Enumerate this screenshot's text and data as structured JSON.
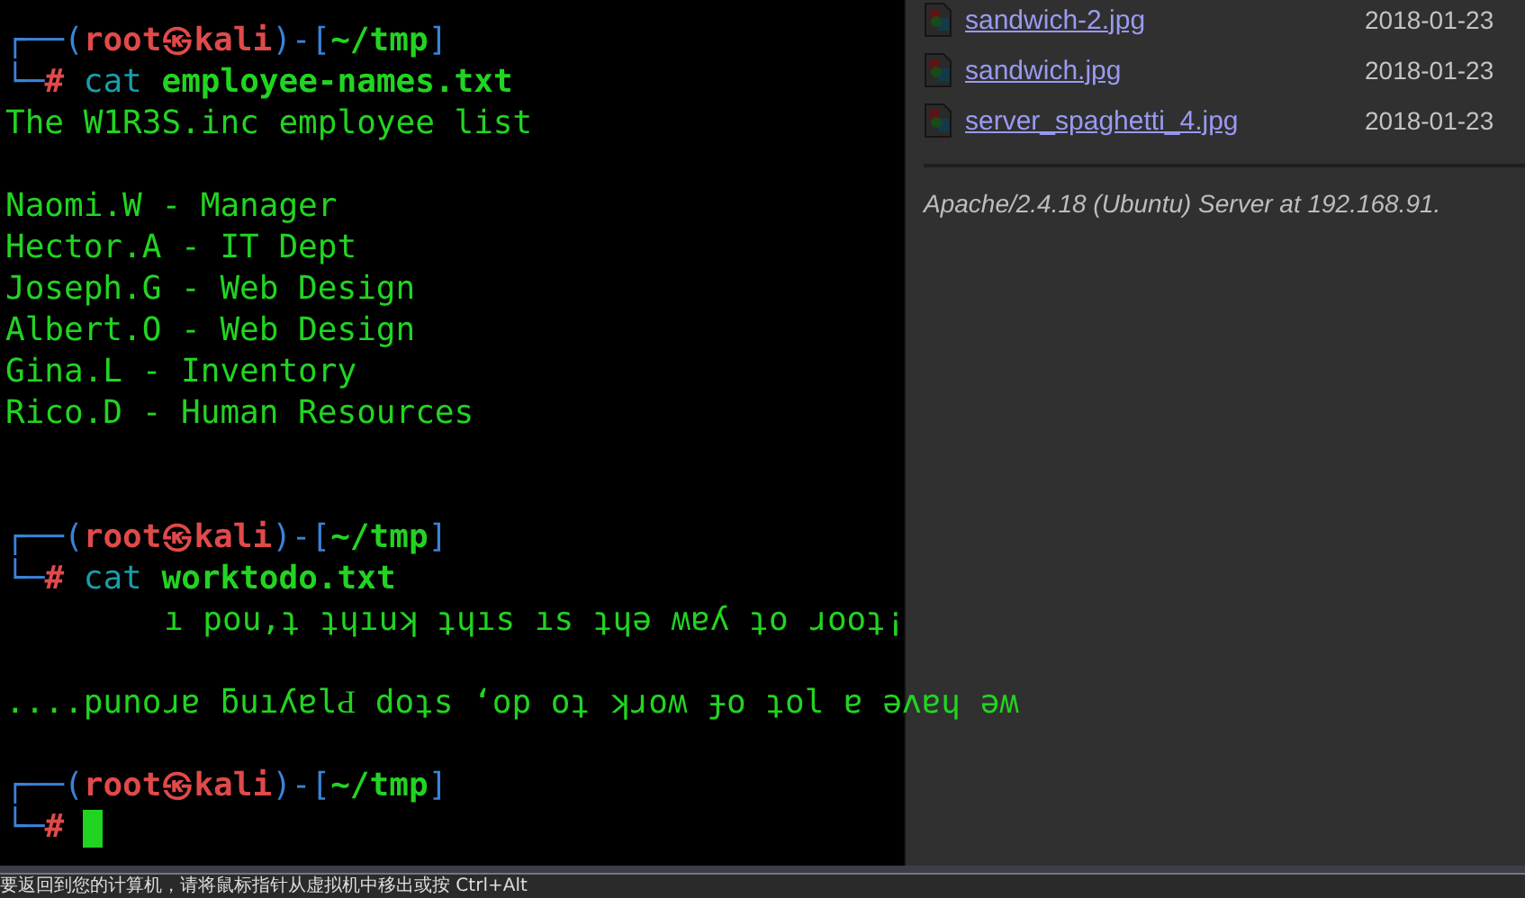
{
  "terminal": {
    "blocks": [
      {
        "prompt": {
          "frame_top": "┌──(",
          "user": "root",
          "separator": "㉿",
          "host": "kali",
          "path_open": ")-[",
          "path": "~/tmp",
          "path_close": "]",
          "frame_bottom": "└─",
          "symbol": "#"
        },
        "command": "cat",
        "argument": "employee-names.txt",
        "output": [
          {
            "kind": "text",
            "text": "The W1R3S.inc employee list"
          },
          {
            "kind": "blank"
          },
          {
            "kind": "text",
            "text": "Naomi.W - Manager"
          },
          {
            "kind": "text",
            "text": "Hector.A - IT Dept"
          },
          {
            "kind": "text",
            "text": "Joseph.G - Web Design"
          },
          {
            "kind": "text",
            "text": "Albert.O - Web Design"
          },
          {
            "kind": "text",
            "text": "Gina.L - Inventory"
          },
          {
            "kind": "text",
            "text": "Rico.D - Human Resources"
          },
          {
            "kind": "blank"
          },
          {
            "kind": "blank"
          }
        ]
      },
      {
        "prompt": {
          "frame_top": "┌──(",
          "user": "root",
          "separator": "㉿",
          "host": "kali",
          "path_open": ")-[",
          "path": "~/tmp",
          "path_close": "]",
          "frame_bottom": "└─",
          "symbol": "#"
        },
        "command": "cat",
        "argument": "worktodo.txt",
        "output": [
          {
            "kind": "indented",
            "text": "ı pou,ʇ ʇɥıuʞ ʇɥıs ıs ʇɥǝ ʍɐʎ ʇo ɹooʇ¡"
          },
          {
            "kind": "blank"
          },
          {
            "kind": "text",
            "text": "....punoɹɐ ƃuıʎɐlԀ doʇs ‘op oʇ ʞɹoʍ ɟo ʇol ɐ ǝʌɐɥ ǝʍ"
          },
          {
            "kind": "blank"
          }
        ]
      },
      {
        "prompt": {
          "frame_top": "┌──(",
          "user": "root",
          "separator": "㉿",
          "host": "kali",
          "path_open": ")-[",
          "path": "~/tmp",
          "path_close": "]",
          "frame_bottom": "└─",
          "symbol": "#"
        },
        "cursor": true
      }
    ]
  },
  "browser": {
    "files": [
      {
        "name": "sandwich-2.jpg",
        "date": "2018-01-23"
      },
      {
        "name": "sandwich.jpg",
        "date": "2018-01-23"
      },
      {
        "name": "server_spaghetti_4.jpg",
        "date": "2018-01-23"
      }
    ],
    "footer": "Apache/2.4.18 (Ubuntu) Server at 192.168.91."
  },
  "status_bar": {
    "text": "要返回到您的计算机，请将鼠标指针从虚拟机中移出或按 Ctrl+Alt"
  }
}
